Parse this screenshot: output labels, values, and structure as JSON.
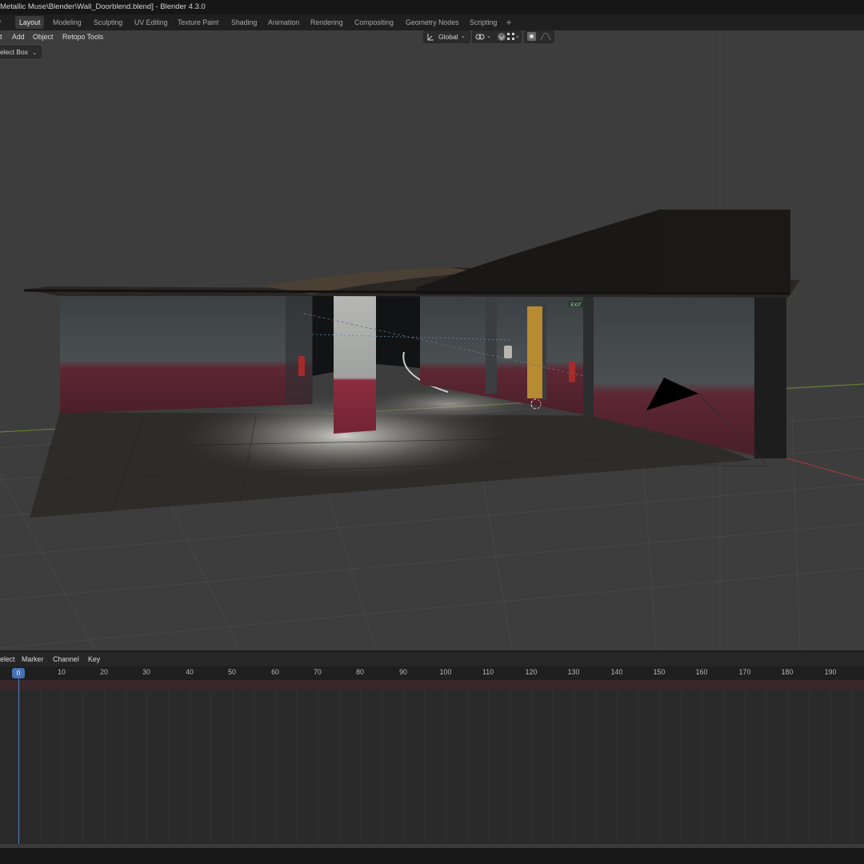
{
  "window": {
    "title": "Metallic Muse\\Blender\\Wall_Doorblend.blend] - Blender 4.3.0"
  },
  "workspaces": [
    {
      "label": "Layout",
      "active": true
    },
    {
      "label": "Modeling",
      "active": false
    },
    {
      "label": "Sculpting",
      "active": false
    },
    {
      "label": "UV Editing",
      "active": false
    },
    {
      "label": "Texture Paint",
      "active": false
    },
    {
      "label": "Shading",
      "active": false
    },
    {
      "label": "Animation",
      "active": false
    },
    {
      "label": "Rendering",
      "active": false
    },
    {
      "label": "Compositing",
      "active": false
    },
    {
      "label": "Geometry Nodes",
      "active": false
    },
    {
      "label": "Scripting",
      "active": false
    }
  ],
  "viewport": {
    "menu": {
      "select_partial": "t",
      "add": "Add",
      "object": "Object",
      "retopo_tools": "Retopo Tools"
    },
    "select_tool": "elect Box",
    "transform_orientation": "Global",
    "scene_sign_text": "EXIT",
    "icons": [
      "chevron-down-icon",
      "transform-orientation-icon",
      "snap-icon",
      "magnet-icon",
      "grid-snap-icon",
      "proportional-edit-icon",
      "falloff-curve-icon"
    ]
  },
  "timeline": {
    "menu": {
      "select_partial": "elect",
      "marker": "Marker",
      "channel": "Channel",
      "key": "Key"
    },
    "current_frame": "0",
    "ticks": [
      "10",
      "20",
      "30",
      "40",
      "50",
      "60",
      "70",
      "80",
      "90",
      "100",
      "110",
      "120",
      "130",
      "140",
      "150",
      "160",
      "170",
      "180",
      "190"
    ]
  },
  "colors": {
    "accent": "#4772b3",
    "viewport_bg": "#3d3d3d",
    "wall_stripe": "#7a2c3a",
    "x_axis": "#b03a44",
    "y_axis": "#7e9a3a"
  }
}
